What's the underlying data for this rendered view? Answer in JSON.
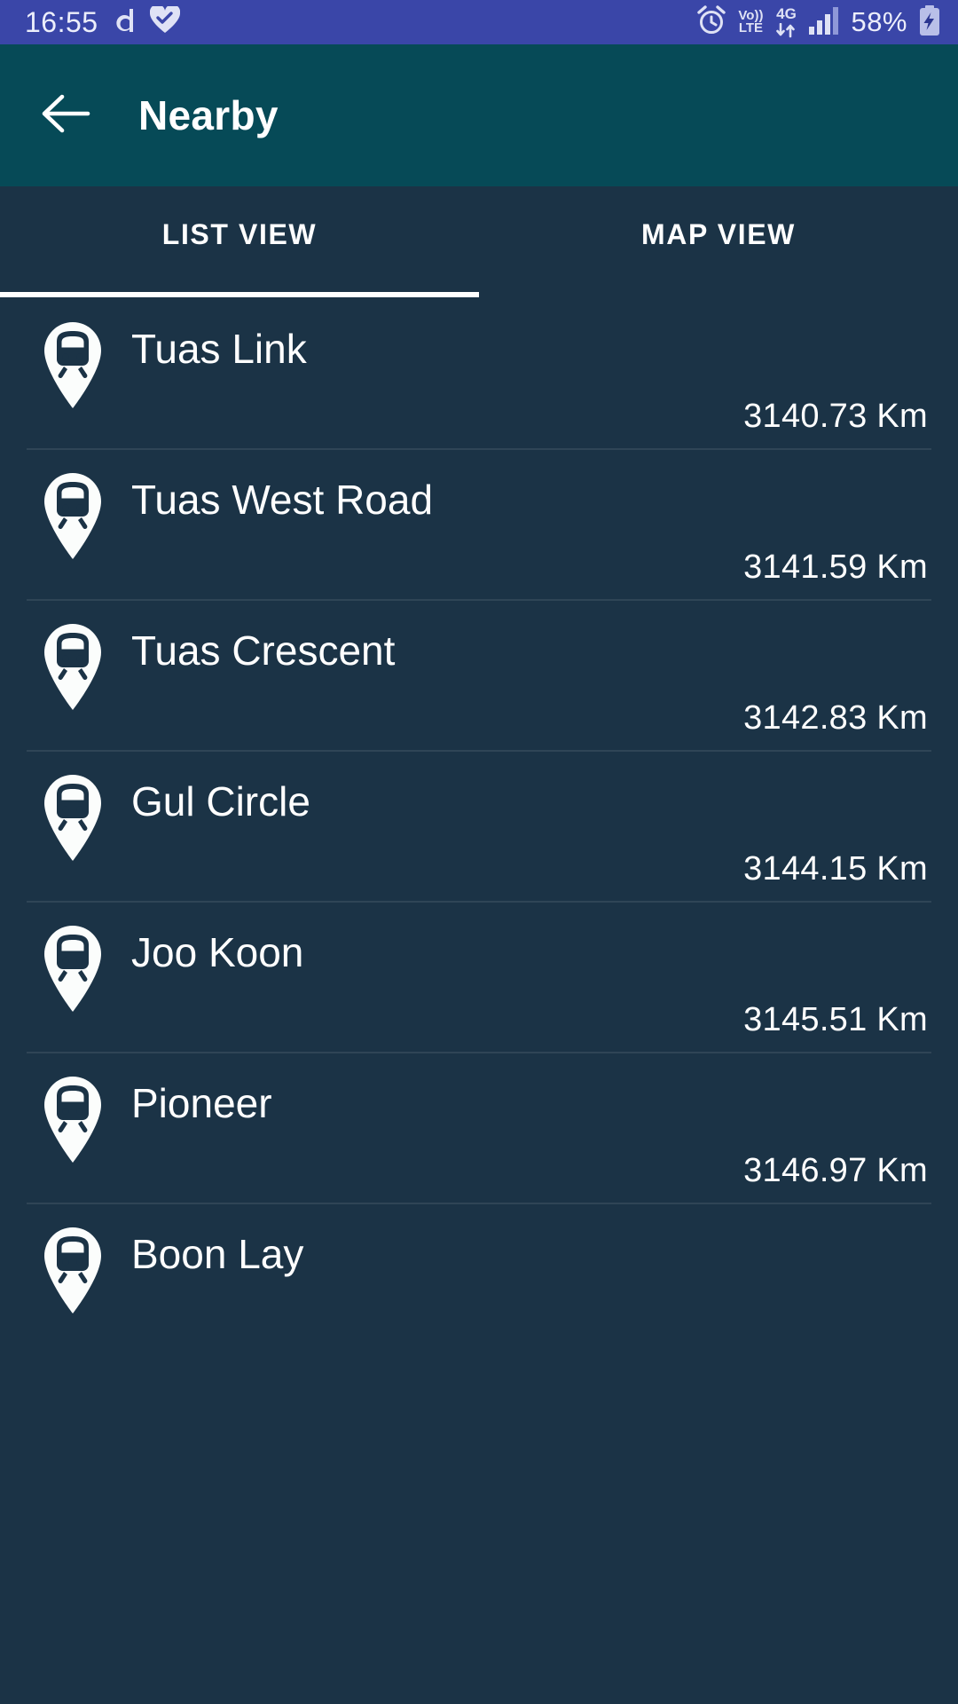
{
  "status_bar": {
    "time": "16:55",
    "left_icons": [
      "app-d-icon",
      "heart-check-icon"
    ],
    "right_icons": [
      "alarm-icon",
      "volte-icon",
      "4g-data-icon",
      "signal-bars-icon"
    ],
    "volte_top": "Vo))",
    "volte_bottom": "LTE",
    "network_type": "4G",
    "battery_percent": "58%",
    "battery_state": "charging",
    "background_color": "#3a46a8"
  },
  "app_bar": {
    "back_icon": "arrow-left-icon",
    "title": "Nearby",
    "background_color": "#064a57"
  },
  "tabs": {
    "items": [
      {
        "label": "LIST VIEW",
        "active": true
      },
      {
        "label": "MAP VIEW",
        "active": false
      }
    ],
    "indicator_color": "#ffffff",
    "background_color": "#1b3346"
  },
  "list": {
    "icon": "train-station-pin-icon",
    "distance_unit": "Km",
    "items": [
      {
        "name": "Tuas Link",
        "distance": "3140.73 Km"
      },
      {
        "name": "Tuas West Road",
        "distance": "3141.59 Km"
      },
      {
        "name": "Tuas Crescent",
        "distance": "3142.83 Km"
      },
      {
        "name": "Gul Circle",
        "distance": "3144.15 Km"
      },
      {
        "name": "Joo Koon",
        "distance": "3145.51 Km"
      },
      {
        "name": "Pioneer",
        "distance": "3146.97 Km"
      },
      {
        "name": "Boon Lay",
        "distance": ""
      }
    ]
  }
}
